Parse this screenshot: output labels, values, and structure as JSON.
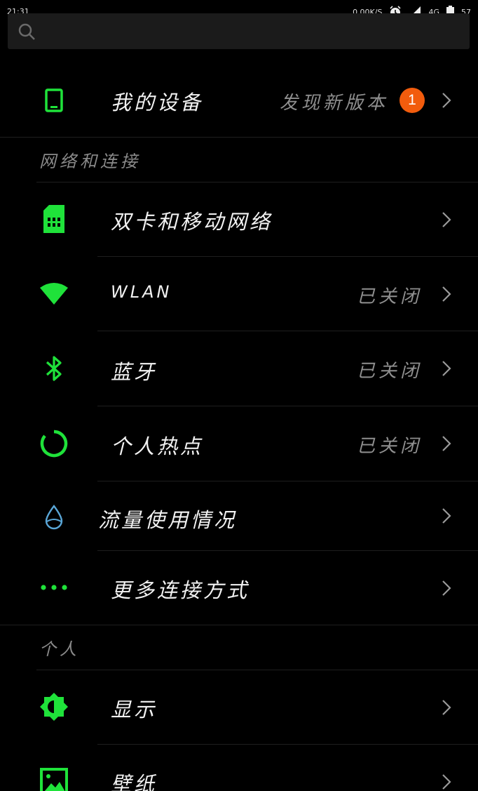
{
  "status_bar": {
    "time": "21:31",
    "net_speed": "0.00K/S",
    "network": "4G",
    "battery": "57"
  },
  "search": {
    "icon": "search-icon",
    "placeholder": ""
  },
  "my_device": {
    "label": "我的设备",
    "value": "发现新版本",
    "badge": "1",
    "icon": "phone-icon"
  },
  "sections": {
    "network": "网络和连接",
    "personal": "个人"
  },
  "items": {
    "dual_sim": {
      "label": "双卡和移动网络",
      "icon": "sim-card-icon"
    },
    "wlan": {
      "label": "WLAN",
      "value": "已关闭",
      "icon": "wifi-icon"
    },
    "bluetooth": {
      "label": "蓝牙",
      "value": "已关闭",
      "icon": "bluetooth-icon"
    },
    "hotspot": {
      "label": "个人热点",
      "value": "已关闭",
      "icon": "hotspot-icon"
    },
    "data_usage": {
      "label": "流量使用情况",
      "icon": "water-drop-icon"
    },
    "more_connections": {
      "label": "更多连接方式",
      "icon": "more-dots-icon"
    },
    "display": {
      "label": "显示",
      "icon": "brightness-icon"
    },
    "wallpaper": {
      "label": "壁纸",
      "icon": "wallpaper-icon"
    }
  },
  "colors": {
    "accent_green": "#1fe23a",
    "badge_orange": "#f25c0d",
    "drop_blue": "#5aa7d8"
  }
}
